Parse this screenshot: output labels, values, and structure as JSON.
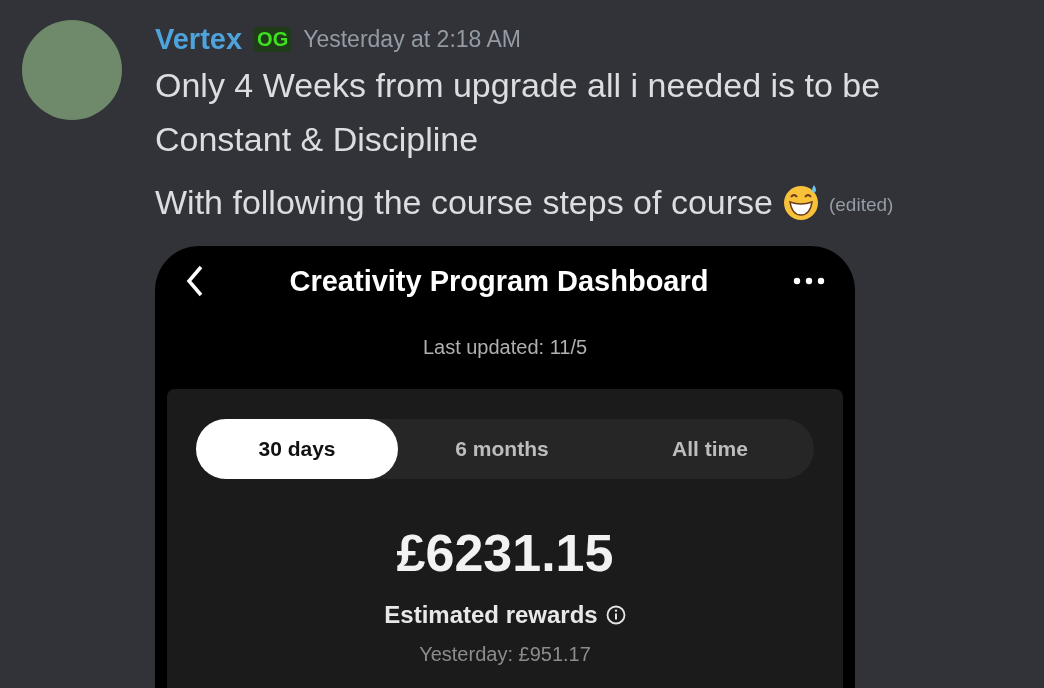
{
  "message": {
    "author": "Vertex",
    "badge": "OG",
    "timestamp": "Yesterday at 2:18 AM",
    "paragraphs": [
      "Only 4 Weeks from upgrade all i needed is to be Constant & Discipline",
      "With following the course steps of course"
    ],
    "edited": "(edited)"
  },
  "attachment": {
    "title": "Creativity Program Dashboard",
    "subtitle": "Last updated: 11/5",
    "tabs": [
      {
        "label": "30 days",
        "selected": true
      },
      {
        "label": "6 months",
        "selected": false
      },
      {
        "label": "All time",
        "selected": false
      }
    ],
    "amount": "£6231.15",
    "amount_label": "Estimated rewards",
    "yesterday": "Yesterday: £951.17"
  }
}
